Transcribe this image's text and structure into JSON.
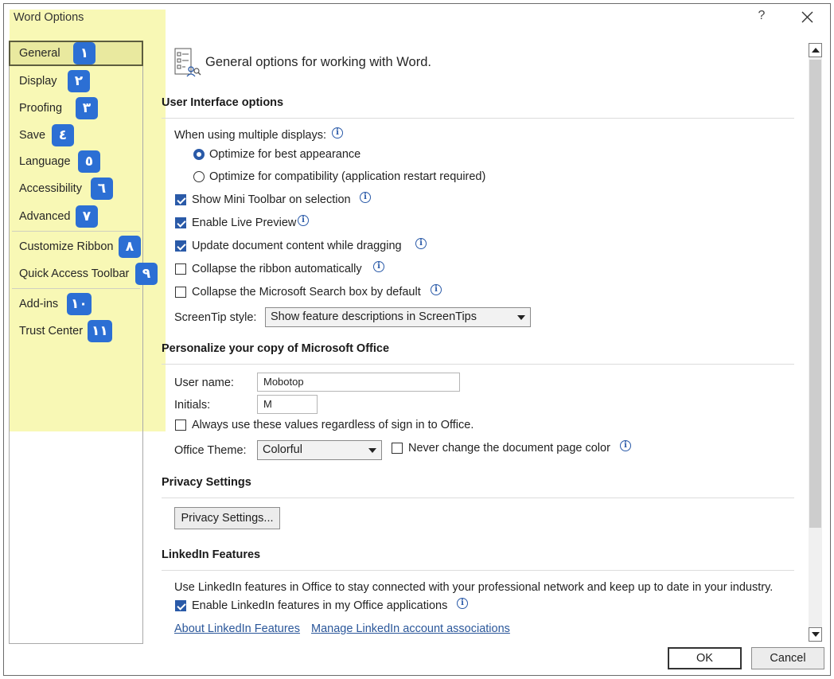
{
  "window": {
    "title": "Word Options",
    "help_label": "?"
  },
  "sidebar": {
    "items": [
      {
        "label": "General",
        "badge": "١",
        "selected": true
      },
      {
        "label": "Display",
        "badge": "٢"
      },
      {
        "label": "Proofing",
        "badge": "٣"
      },
      {
        "label": "Save",
        "badge": "٤"
      },
      {
        "label": "Language",
        "badge": "٥"
      },
      {
        "label": "Accessibility",
        "badge": "٦"
      },
      {
        "label": "Advanced",
        "badge": "٧"
      },
      {
        "label": "Customize Ribbon",
        "badge": "٨"
      },
      {
        "label": "Quick Access Toolbar",
        "badge": "٩"
      },
      {
        "label": "Add-ins",
        "badge": "١٠"
      },
      {
        "label": "Trust Center",
        "badge": "١١"
      }
    ]
  },
  "main": {
    "header": "General options for working with Word.",
    "ui_options": {
      "title": "User Interface options",
      "multiple_displays_label": "When using multiple displays:",
      "radio_best": "Optimize for best appearance",
      "radio_compat": "Optimize for compatibility (application restart required)",
      "mini_toolbar": "Show Mini Toolbar on selection",
      "live_preview": "Enable Live Preview",
      "update_dragging": "Update document content while dragging",
      "collapse_ribbon": "Collapse the ribbon automatically",
      "collapse_search": "Collapse the Microsoft Search box by default",
      "screentip_label": "ScreenTip style:",
      "screentip_value": "Show feature descriptions in ScreenTips"
    },
    "personalize": {
      "title": "Personalize your copy of Microsoft Office",
      "username_label": "User name:",
      "username_value": "Mobotop",
      "initials_label": "Initials:",
      "initials_value": "M",
      "always_use": "Always use these values regardless of sign in to Office.",
      "theme_label": "Office Theme:",
      "theme_value": "Colorful",
      "never_change": "Never change the document page color"
    },
    "privacy": {
      "title": "Privacy Settings",
      "button": "Privacy Settings..."
    },
    "linkedin": {
      "title": "LinkedIn Features",
      "description": "Use LinkedIn features in Office to stay connected with your professional network and keep up to date in your industry.",
      "enable": "Enable LinkedIn features in my Office applications",
      "about_link": "About LinkedIn Features",
      "manage_link": "Manage LinkedIn account associations"
    }
  },
  "footer": {
    "ok": "OK",
    "cancel": "Cancel"
  },
  "colors": {
    "accent": "#2a5aa8",
    "badge": "#2c6fd4",
    "highlight": "#f0f064",
    "link": "#2b579a"
  }
}
